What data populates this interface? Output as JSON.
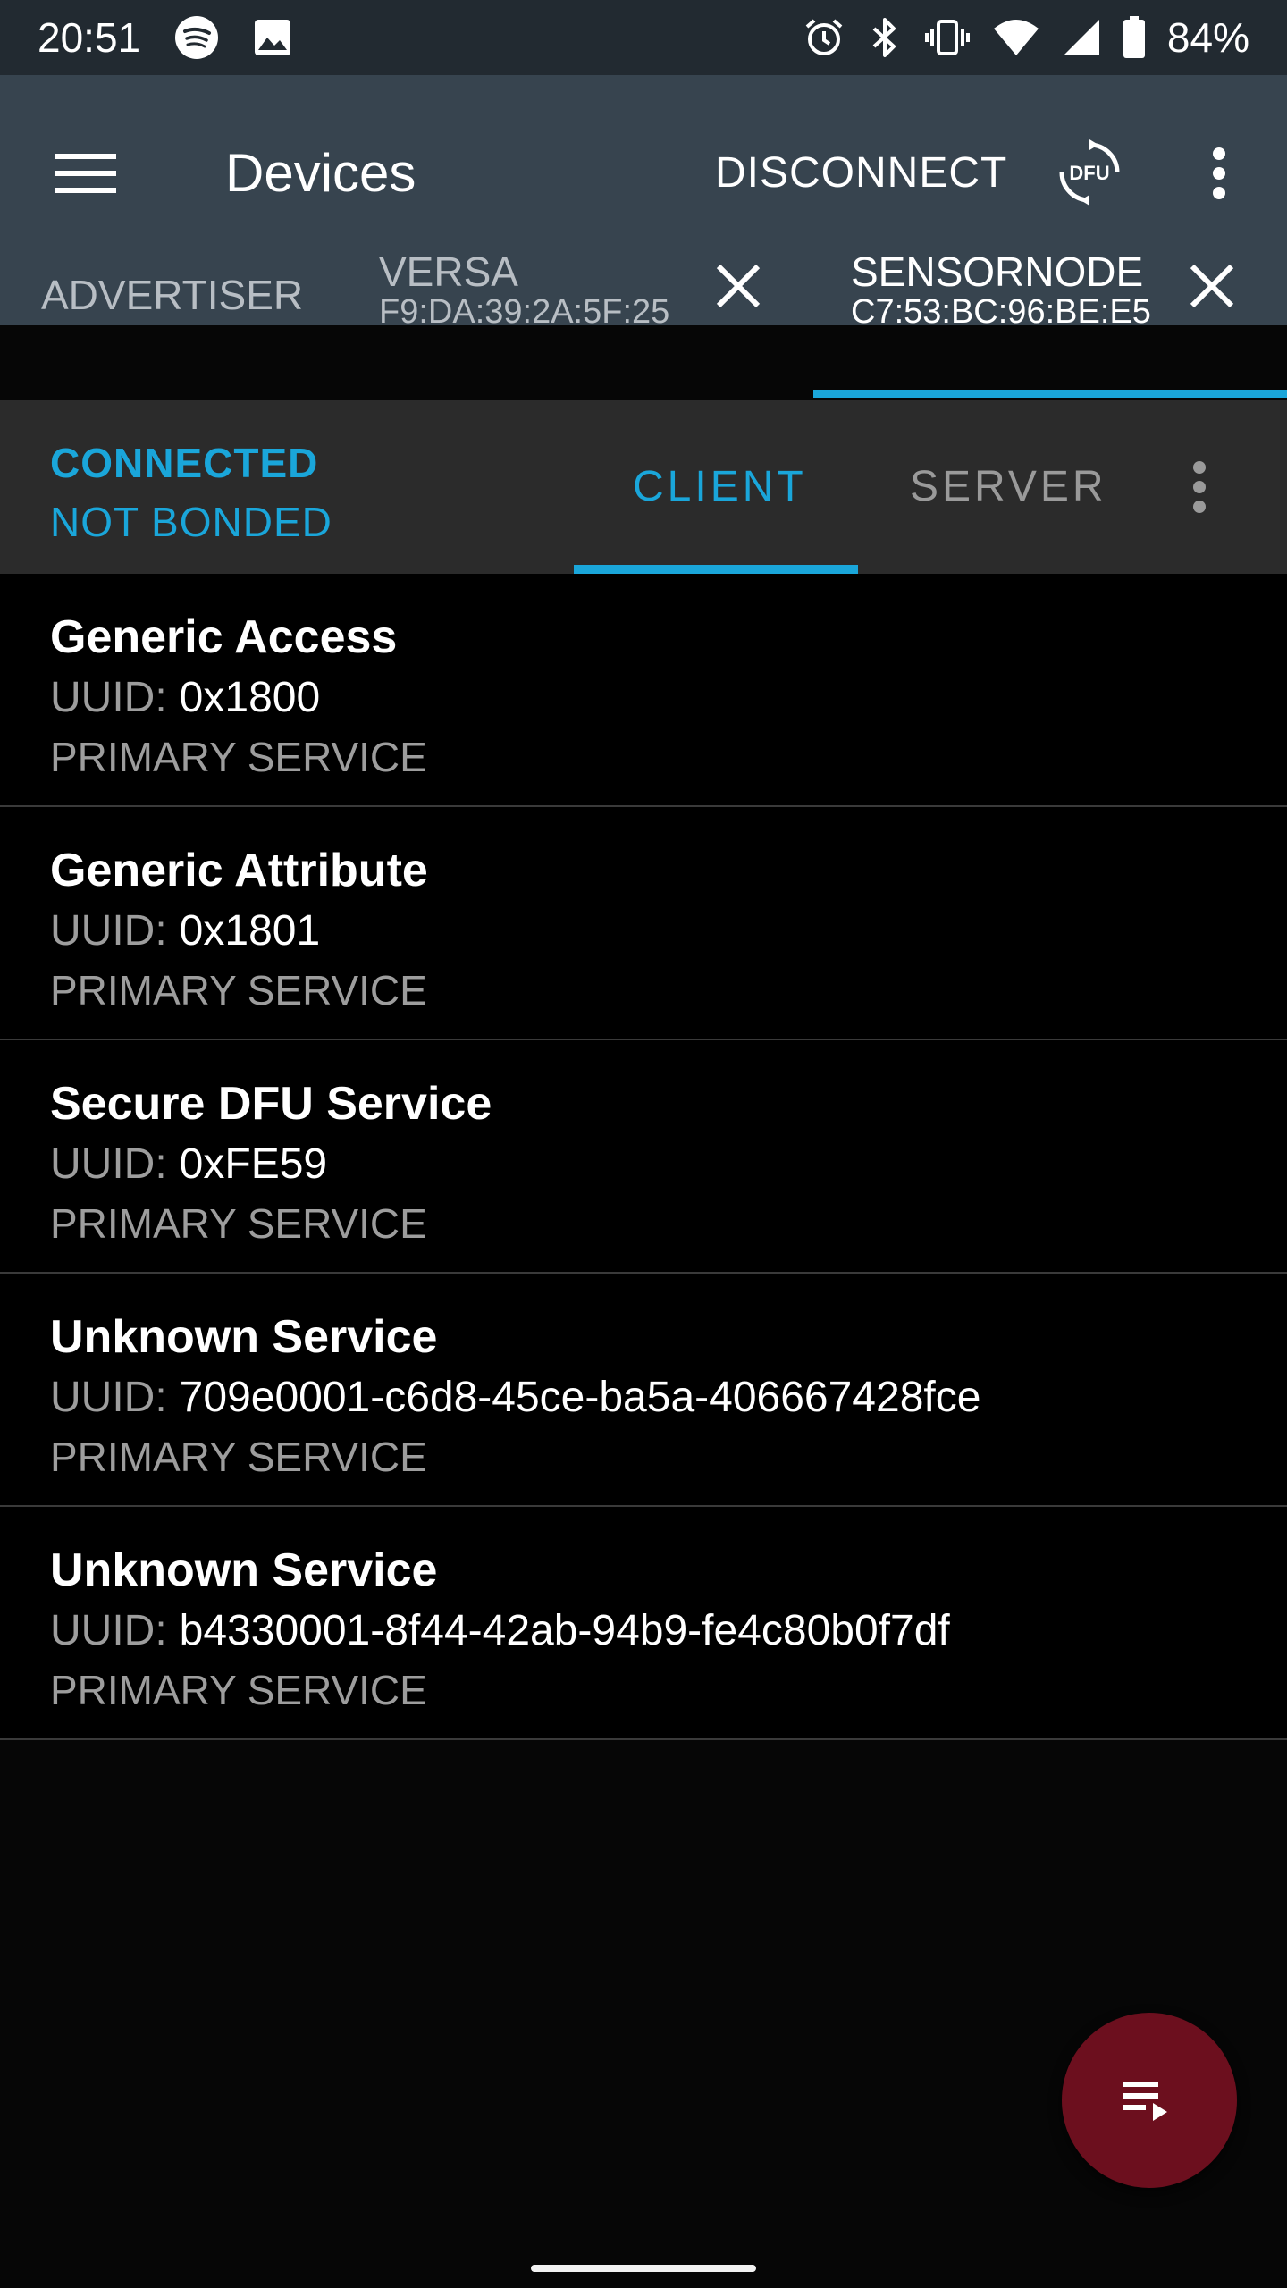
{
  "status_bar": {
    "time": "20:51",
    "battery": "84%",
    "left_icons": [
      "spotify-icon",
      "image-icon"
    ],
    "right_icons": [
      "alarm-icon",
      "bluetooth-icon",
      "vibrate-icon",
      "wifi-icon",
      "signal-icon",
      "battery-icon"
    ]
  },
  "toolbar": {
    "title": "Devices",
    "disconnect_label": "DISCONNECT",
    "dfu_label": "DFU"
  },
  "device_tabs": {
    "advertiser_label": "ADVERTISER",
    "tabs": [
      {
        "name": "VERSA",
        "address": "F9:DA:39:2A:5F:25"
      },
      {
        "name": "SENSORNODE",
        "address": "C7:53:BC:96:BE:E5"
      }
    ]
  },
  "connection": {
    "state": "CONNECTED",
    "bond": "NOT BONDED",
    "tabs": {
      "client": "CLIENT",
      "server": "SERVER"
    }
  },
  "services": [
    {
      "name": "Generic Access",
      "uuid_label": "UUID:",
      "uuid": "0x1800",
      "type": "PRIMARY SERVICE"
    },
    {
      "name": "Generic Attribute",
      "uuid_label": "UUID:",
      "uuid": "0x1801",
      "type": "PRIMARY SERVICE"
    },
    {
      "name": "Secure DFU Service",
      "uuid_label": "UUID:",
      "uuid": "0xFE59",
      "type": "PRIMARY SERVICE"
    },
    {
      "name": "Unknown Service",
      "uuid_label": "UUID:",
      "uuid": "709e0001-c6d8-45ce-ba5a-406667428fce",
      "type": "PRIMARY SERVICE"
    },
    {
      "name": "Unknown Service",
      "uuid_label": "UUID:",
      "uuid": "b4330001-8f44-42ab-94b9-fe4c80b0f7df",
      "type": "PRIMARY SERVICE"
    }
  ],
  "colors": {
    "accent": "#1aa6da",
    "app_bar": "#37444f",
    "status_bar": "#222a31",
    "fab": "#6c0f1e"
  }
}
